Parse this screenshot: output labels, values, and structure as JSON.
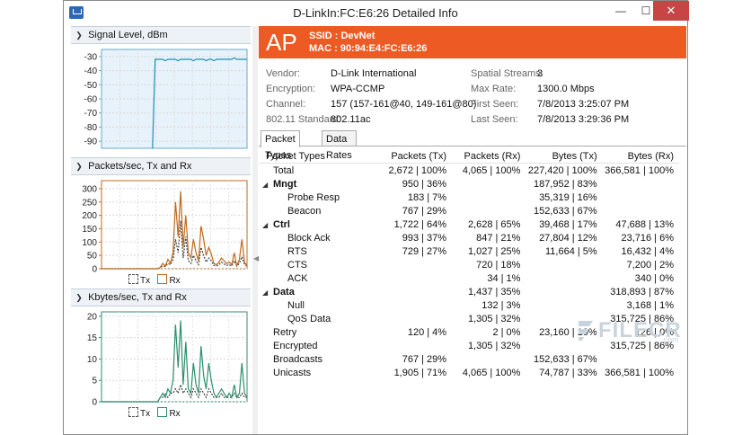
{
  "window": {
    "title": "D-LinkIn:FC:E6:26 Detailed Info",
    "minimize": "—",
    "maximize": "☐",
    "close": "✕"
  },
  "panels": [
    {
      "title": "Signal Level, dBm"
    },
    {
      "title": "Packets/sec, Tx and Rx",
      "legend_tx": "Tx",
      "legend_rx": "Rx"
    },
    {
      "title": "Kbytes/sec, Tx and Rx",
      "legend_tx": "Tx",
      "legend_rx": "Rx"
    }
  ],
  "header": {
    "badge": "AP",
    "ssid": "SSID : DevNet",
    "mac": "MAC : 90:94:E4:FC:E6:26",
    "color": "#ee5a24"
  },
  "info": {
    "vendor_label": "Vendor:",
    "vendor": "D-Link International",
    "encryption_label": "Encryption:",
    "encryption": "WPA-CCMP",
    "channel_label": "Channel:",
    "channel": "157 (157-161@40, 149-161@80)",
    "standard_label": "802.11 Standard:",
    "standard": "802.11ac",
    "streams_label": "Spatial Streams:",
    "streams": "3",
    "maxrate_label": "Max Rate:",
    "maxrate": "1300.0 Mbps",
    "firstseen_label": "First Seen:",
    "firstseen": "7/8/2013 3:25:07 PM",
    "lastseen_label": "Last Seen:",
    "lastseen": "7/8/2013 3:29:36 PM"
  },
  "tabs": [
    "Packet Types",
    "Data Rates"
  ],
  "table": {
    "headers": [
      "Packet Types",
      "Packets (Tx)",
      "Packets (Rx)",
      "Bytes (Tx)",
      "Bytes (Rx)"
    ],
    "rows": [
      {
        "label": "Total",
        "indent": 1,
        "tx": "2,672 | 100%",
        "rx": "4,065 | 100%",
        "btx": "227,420 | 100%",
        "brx": "366,581 | 100%"
      },
      {
        "label": "Mngt",
        "indent": 0,
        "group": true,
        "tx": "950 | 36%",
        "rx": "",
        "btx": "187,952 | 83%",
        "brx": ""
      },
      {
        "label": "Probe Resp",
        "indent": 2,
        "tx": "183 | 7%",
        "rx": "",
        "btx": "35,319 | 16%",
        "brx": ""
      },
      {
        "label": "Beacon",
        "indent": 2,
        "tx": "767 | 29%",
        "rx": "",
        "btx": "152,633 | 67%",
        "brx": ""
      },
      {
        "label": "Ctrl",
        "indent": 0,
        "group": true,
        "tx": "1,722 | 64%",
        "rx": "2,628 | 65%",
        "btx": "39,468 | 17%",
        "brx": "47,688 | 13%"
      },
      {
        "label": "Block Ack",
        "indent": 2,
        "tx": "993 | 37%",
        "rx": "847 | 21%",
        "btx": "27,804 | 12%",
        "brx": "23,716 | 6%"
      },
      {
        "label": "RTS",
        "indent": 2,
        "tx": "729 | 27%",
        "rx": "1,027 | 25%",
        "btx": "11,664 | 5%",
        "brx": "16,432 | 4%"
      },
      {
        "label": "CTS",
        "indent": 2,
        "tx": "",
        "rx": "720 | 18%",
        "btx": "",
        "brx": "7,200 | 2%"
      },
      {
        "label": "ACK",
        "indent": 2,
        "tx": "",
        "rx": "34 | 1%",
        "btx": "",
        "brx": "340 | 0%"
      },
      {
        "label": "Data",
        "indent": 0,
        "group": true,
        "tx": "",
        "rx": "1,437 | 35%",
        "btx": "",
        "brx": "318,893 | 87%"
      },
      {
        "label": "Null",
        "indent": 2,
        "tx": "",
        "rx": "132 | 3%",
        "btx": "",
        "brx": "3,168 | 1%"
      },
      {
        "label": "QoS Data",
        "indent": 2,
        "tx": "",
        "rx": "1,305 | 32%",
        "btx": "",
        "brx": "315,725 | 86%"
      },
      {
        "label": "Retry",
        "indent": 1,
        "tx": "120 | 4%",
        "rx": "2 | 0%",
        "btx": "23,160 | 10%",
        "brx": "126 | 0%"
      },
      {
        "label": "Encrypted",
        "indent": 1,
        "tx": "",
        "rx": "1,305 | 32%",
        "btx": "",
        "brx": "315,725 | 86%"
      },
      {
        "label": "Broadcasts",
        "indent": 1,
        "tx": "767 | 29%",
        "rx": "",
        "btx": "152,633 | 67%",
        "brx": ""
      },
      {
        "label": "Unicasts",
        "indent": 1,
        "tx": "1,905 | 71%",
        "rx": "4,065 | 100%",
        "btx": "74,787 | 33%",
        "brx": "366,581 | 100%"
      }
    ]
  },
  "watermark": {
    "text": "FILECR",
    "suffix": ".com"
  },
  "chart_data": [
    {
      "type": "line",
      "title": "Signal Level, dBm",
      "yticks": [
        -30,
        -40,
        -50,
        -60,
        -70,
        -80,
        -90
      ],
      "ylim": [
        -95,
        -25
      ],
      "series": [
        {
          "values": [
            null,
            null,
            null,
            null,
            null,
            null,
            null,
            null,
            null,
            null,
            null,
            null,
            null,
            null,
            null,
            null,
            null,
            null,
            null,
            null,
            -100,
            -32,
            -32,
            -32,
            -32,
            -33,
            -32,
            -32,
            -32,
            -32,
            -33,
            -32,
            -32,
            -32,
            -32,
            -32,
            -33,
            -32,
            -32,
            -32,
            -32,
            -33,
            -32,
            -32,
            -33,
            -32,
            -32,
            -32,
            -32,
            -32,
            -32,
            -32,
            -31,
            -32,
            -32,
            -32,
            -32,
            -32
          ]
        }
      ],
      "color": "#1b8fb8",
      "bg": "#e7f2fa"
    },
    {
      "type": "line",
      "title": "Packets/sec, Tx and Rx",
      "yticks": [
        0,
        50,
        100,
        150,
        200,
        250,
        300
      ],
      "ylim": [
        0,
        330
      ],
      "series": [
        {
          "name": "Tx",
          "values": [
            0,
            0,
            0,
            0,
            0,
            0,
            0,
            0,
            0,
            0,
            0,
            0,
            0,
            0,
            0,
            0,
            0,
            0,
            0,
            0,
            0,
            0,
            0,
            5,
            10,
            8,
            20,
            15,
            35,
            110,
            60,
            180,
            40,
            120,
            30,
            20,
            50,
            30,
            15,
            80,
            50,
            25,
            40,
            30,
            12,
            10,
            15,
            25,
            18,
            12,
            15,
            10,
            30,
            10,
            20,
            45,
            15,
            10
          ],
          "dashed": true,
          "color": "#444"
        },
        {
          "name": "Rx",
          "values": [
            0,
            0,
            0,
            0,
            0,
            0,
            0,
            0,
            0,
            0,
            0,
            0,
            0,
            0,
            0,
            0,
            0,
            0,
            0,
            0,
            0,
            0,
            0,
            5,
            20,
            10,
            35,
            20,
            60,
            250,
            120,
            290,
            80,
            200,
            60,
            40,
            110,
            60,
            30,
            160,
            110,
            50,
            80,
            55,
            20,
            15,
            25,
            40,
            30,
            20,
            25,
            15,
            60,
            10,
            35,
            110,
            25,
            10
          ],
          "color": "#c06a1c"
        }
      ]
    },
    {
      "type": "line",
      "title": "Kbytes/sec, Tx and Rx",
      "yticks": [
        0,
        5,
        10,
        15,
        20
      ],
      "ylim": [
        0,
        21
      ],
      "series": [
        {
          "name": "Tx",
          "values": [
            0,
            0,
            0,
            0,
            0,
            0,
            0,
            0,
            0,
            0,
            0,
            0,
            0,
            0,
            0,
            0,
            0,
            0,
            0,
            0,
            0,
            0,
            0,
            1,
            1,
            2,
            1,
            2,
            2,
            3,
            2,
            4,
            2,
            3,
            2,
            1,
            3,
            2,
            1,
            3,
            2,
            1,
            3,
            2,
            1,
            1,
            1,
            2,
            1,
            1,
            1,
            1,
            2,
            1,
            1,
            2,
            1,
            1
          ],
          "dashed": true,
          "color": "#444"
        },
        {
          "name": "Rx",
          "values": [
            0,
            0,
            0,
            0,
            0,
            0,
            0,
            0,
            0,
            0,
            0,
            0,
            0,
            0,
            0,
            0,
            0,
            0,
            0,
            0,
            0,
            0,
            0,
            1,
            2,
            1,
            3,
            2,
            5,
            18,
            8,
            19,
            4,
            14,
            3,
            2,
            9,
            4,
            2,
            13,
            6,
            3,
            9,
            5,
            2,
            1,
            2,
            3,
            2,
            1,
            2,
            1,
            4,
            1,
            2,
            9,
            2,
            1
          ],
          "color": "#2c8f6c"
        }
      ]
    }
  ]
}
